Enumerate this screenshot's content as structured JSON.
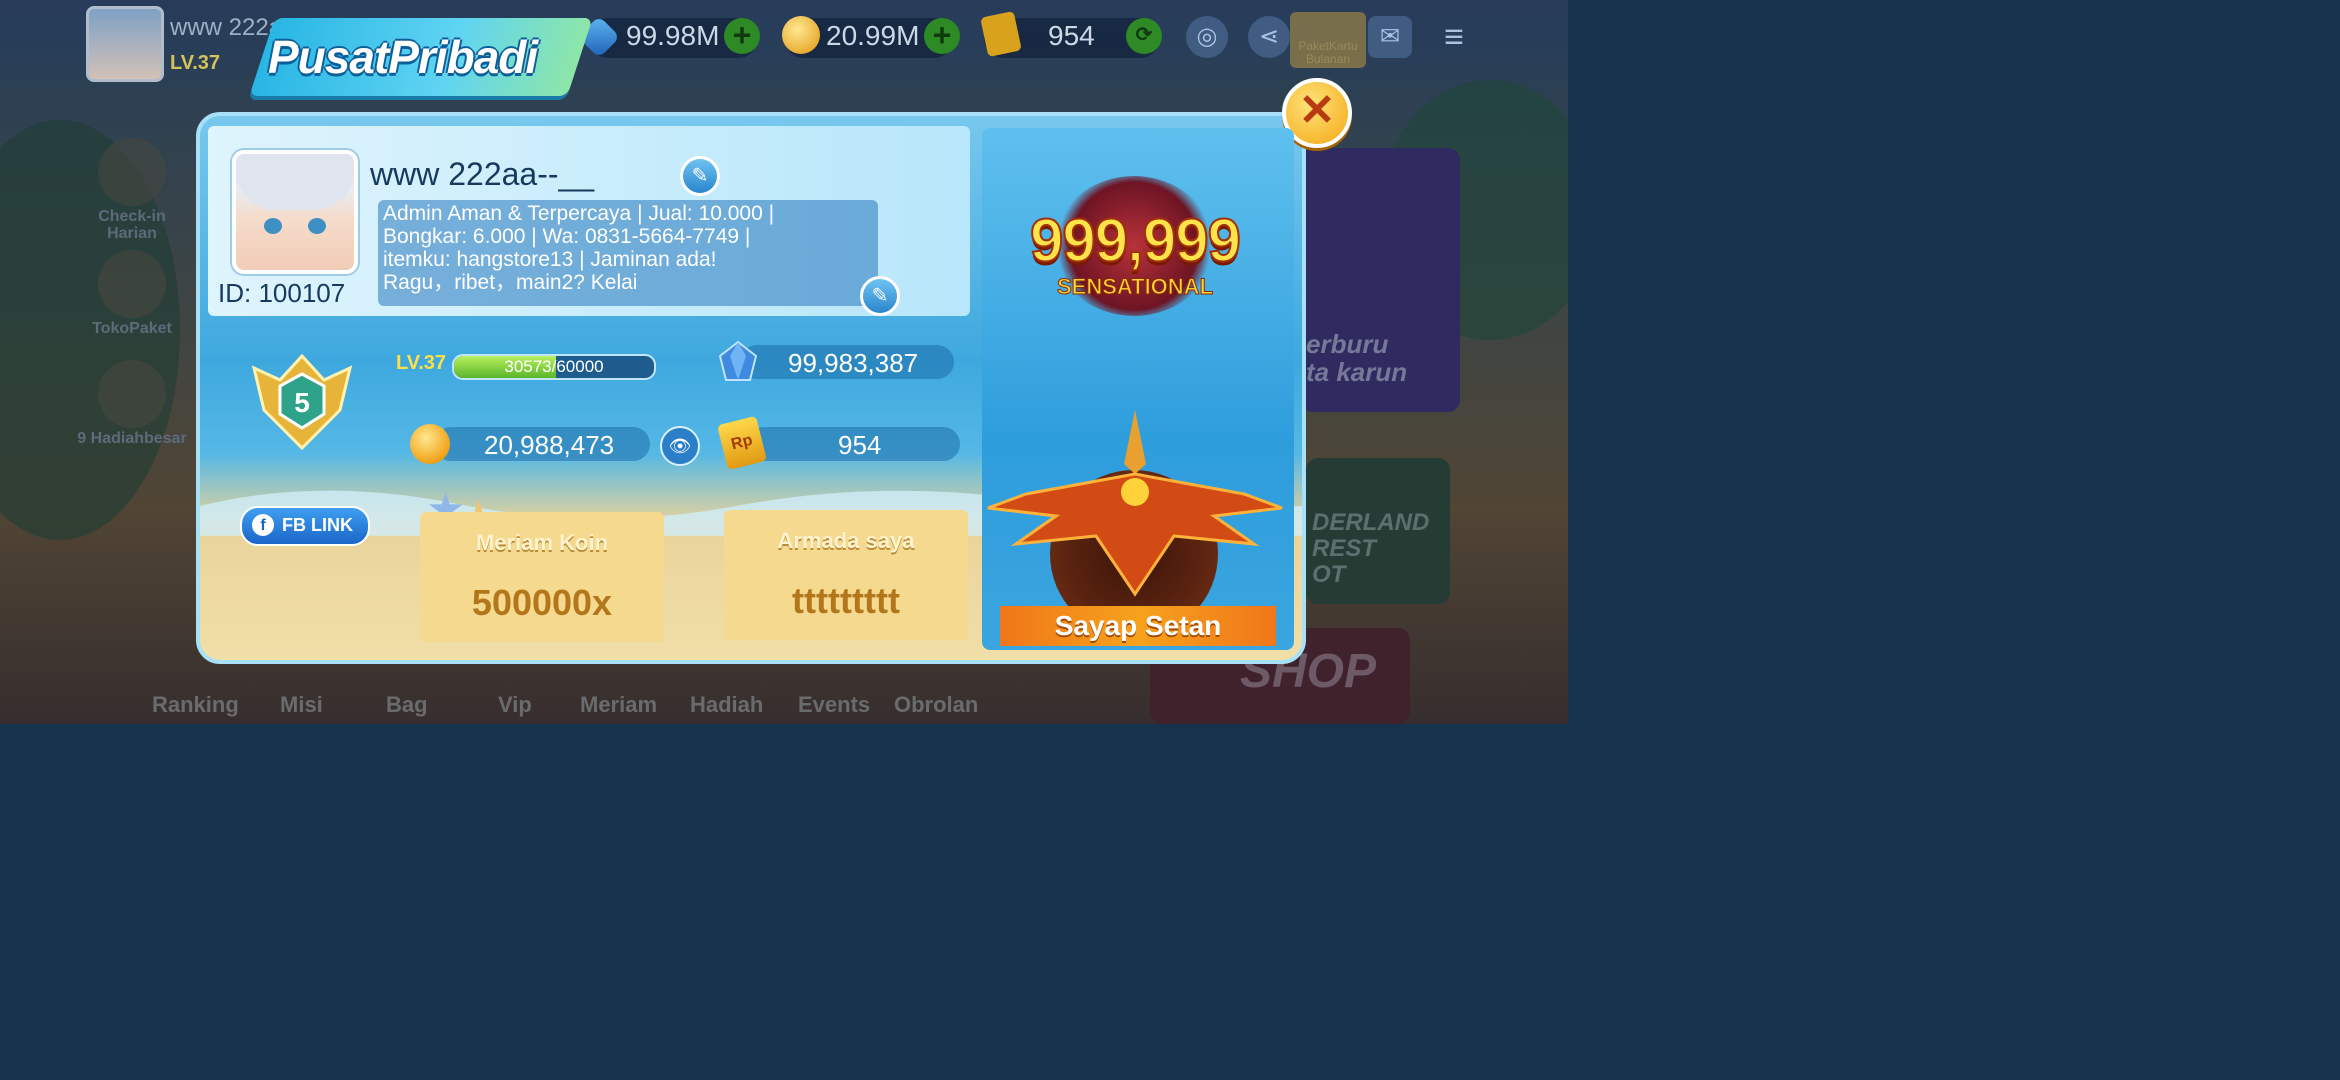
{
  "topbar": {
    "player_name": "www  222aa--",
    "level_short": "LV.37",
    "level_badge": "5",
    "gems": "99.98M",
    "coins": "20.99M",
    "tickets": "954",
    "paket_kartu": "PaketKartu\nBulanan"
  },
  "side_menu": [
    {
      "label": "Check-in\nHarian",
      "icon": "pencil-calendar-icon"
    },
    {
      "label": "TokoPaket",
      "icon": "gift-box-icon"
    },
    {
      "label": "9 Hadiahbesar",
      "icon": "prize-pot-icon"
    }
  ],
  "bottom_nav": [
    "Ranking",
    "Misi",
    "Bag",
    "Vip",
    "Meriam",
    "Hadiah",
    "Events",
    "Obrolan"
  ],
  "background_promos": {
    "promo1": "erburu\nta karun",
    "promo2": "DERLAND\nREST\nOT",
    "shop": "SHOP"
  },
  "panel": {
    "title": "PusatPribadi",
    "close_symbol": "✕",
    "player_name": "www  222aa--__",
    "player_id": "ID: 100107",
    "bio": "Admin Aman & Terpercaya | Jual: 10.000 |\nBongkar: 6.000 | Wa: 0831-5664-7749 |\nitemku: hangstore13 | Jaminan ada!\nRagu，ribet，main2? Kelai",
    "vip_badge": "5",
    "level_label": "LV.37",
    "xp_text": "30573/60000",
    "xp_current": 30573,
    "xp_max": 60000,
    "gems": "99,983,387",
    "coins": "20,988,473",
    "tickets": "954",
    "ticket_icon_text": "Rp",
    "fb_link": "FB LINK",
    "cards": [
      {
        "title": "Meriam Koin",
        "value": "500000x"
      },
      {
        "title": "Armada saya",
        "value": "ttttttttt"
      }
    ],
    "big_multiplier": "999,999",
    "sensational": "SENSATIONAL",
    "ship_name": "Sayap Setan"
  },
  "colors": {
    "accent_gold": "#ffe34a",
    "panel_blue": "#3ea8de",
    "sand": "#f1dfa8",
    "plus_green": "#2e8a25"
  }
}
